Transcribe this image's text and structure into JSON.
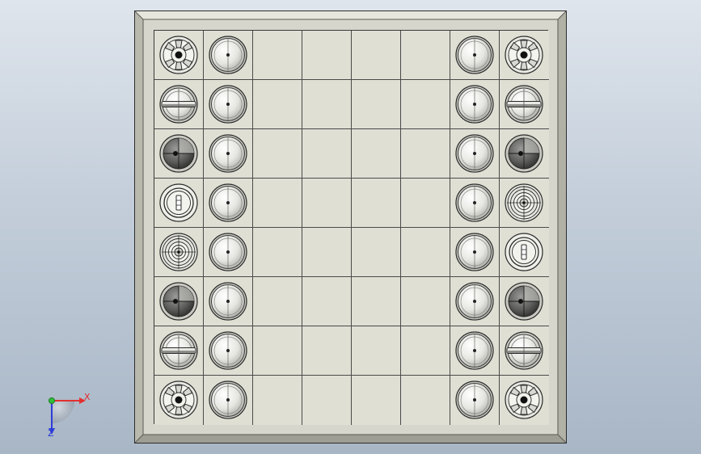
{
  "scene": {
    "title": "",
    "background_top": "#dfe5ec",
    "background_bottom": "#a8b6c6"
  },
  "board": {
    "rows": 8,
    "cols": 8,
    "frame_color": "#cfcfc4",
    "square_color": "#dfdfd4",
    "line_color": "#4a4a4a",
    "pieces": [
      {
        "row": 0,
        "col": 0,
        "type": "wheel"
      },
      {
        "row": 0,
        "col": 1,
        "type": "pawn"
      },
      {
        "row": 0,
        "col": 6,
        "type": "pawn"
      },
      {
        "row": 0,
        "col": 7,
        "type": "wheel"
      },
      {
        "row": 1,
        "col": 0,
        "type": "bar"
      },
      {
        "row": 1,
        "col": 1,
        "type": "pawn"
      },
      {
        "row": 1,
        "col": 6,
        "type": "pawn"
      },
      {
        "row": 1,
        "col": 7,
        "type": "bar"
      },
      {
        "row": 2,
        "col": 0,
        "type": "dome"
      },
      {
        "row": 2,
        "col": 1,
        "type": "pawn"
      },
      {
        "row": 2,
        "col": 6,
        "type": "pawn"
      },
      {
        "row": 2,
        "col": 7,
        "type": "dome"
      },
      {
        "row": 3,
        "col": 0,
        "type": "slot"
      },
      {
        "row": 3,
        "col": 1,
        "type": "pawn"
      },
      {
        "row": 3,
        "col": 6,
        "type": "pawn"
      },
      {
        "row": 3,
        "col": 7,
        "type": "crown"
      },
      {
        "row": 4,
        "col": 0,
        "type": "crown"
      },
      {
        "row": 4,
        "col": 1,
        "type": "pawn"
      },
      {
        "row": 4,
        "col": 6,
        "type": "pawn"
      },
      {
        "row": 4,
        "col": 7,
        "type": "slot"
      },
      {
        "row": 5,
        "col": 0,
        "type": "dome"
      },
      {
        "row": 5,
        "col": 1,
        "type": "pawn"
      },
      {
        "row": 5,
        "col": 6,
        "type": "pawn"
      },
      {
        "row": 5,
        "col": 7,
        "type": "dome"
      },
      {
        "row": 6,
        "col": 0,
        "type": "bar"
      },
      {
        "row": 6,
        "col": 1,
        "type": "pawn"
      },
      {
        "row": 6,
        "col": 6,
        "type": "pawn"
      },
      {
        "row": 6,
        "col": 7,
        "type": "bar"
      },
      {
        "row": 7,
        "col": 0,
        "type": "wheel"
      },
      {
        "row": 7,
        "col": 1,
        "type": "pawn"
      },
      {
        "row": 7,
        "col": 6,
        "type": "pawn"
      },
      {
        "row": 7,
        "col": 7,
        "type": "wheel"
      }
    ]
  },
  "axis": {
    "x_label": "X",
    "y_label": "",
    "z_label": "Z",
    "x_color": "#e23030",
    "y_color": "#2fbf3a",
    "z_color": "#2d3dd8"
  }
}
